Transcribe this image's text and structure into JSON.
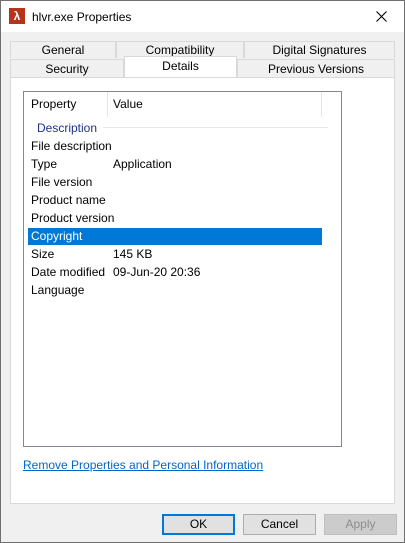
{
  "window": {
    "title": "hlvr.exe Properties",
    "app_icon": "half-life-lambda-icon",
    "app_icon_glyph": "λ"
  },
  "tabs": {
    "row_back": [
      "General",
      "Compatibility",
      "Digital Signatures"
    ],
    "row_front": [
      "Security",
      "Details",
      "Previous Versions"
    ],
    "active": "Details"
  },
  "details": {
    "columns": {
      "property": "Property",
      "value": "Value"
    },
    "group": "Description",
    "rows": [
      {
        "property": "File description",
        "value": ""
      },
      {
        "property": "Type",
        "value": "Application"
      },
      {
        "property": "File version",
        "value": ""
      },
      {
        "property": "Product name",
        "value": ""
      },
      {
        "property": "Product version",
        "value": ""
      },
      {
        "property": "Copyright",
        "value": "",
        "selected": true
      },
      {
        "property": "Size",
        "value": "145 KB"
      },
      {
        "property": "Date modified",
        "value": "09-Jun-20 20:36"
      },
      {
        "property": "Language",
        "value": ""
      }
    ]
  },
  "link": "Remove Properties and Personal Information",
  "buttons": {
    "ok": "OK",
    "cancel": "Cancel",
    "apply": "Apply"
  },
  "colors": {
    "selection": "#0078d7",
    "link": "#0066cc",
    "group": "#1e3287"
  }
}
